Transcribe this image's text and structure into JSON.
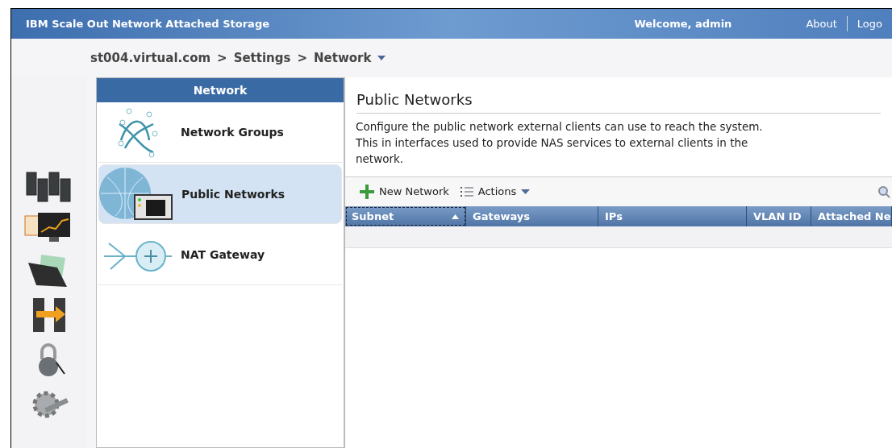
{
  "header": {
    "title": "IBM Scale Out Network Attached Storage",
    "welcome": "Welcome, admin",
    "links": [
      "About",
      "Logo"
    ]
  },
  "breadcrumb": [
    "st004.virtual.com",
    ">",
    "Settings",
    ">",
    "Network"
  ],
  "rail": [
    {
      "kind": "servers"
    },
    {
      "kind": "monitor"
    },
    {
      "kind": "folder"
    },
    {
      "kind": "migrate"
    },
    {
      "kind": "lock"
    },
    {
      "kind": "settings"
    }
  ],
  "nav": {
    "title": "Network",
    "items": [
      {
        "label": "Network Groups",
        "kind": "groups",
        "selected": false
      },
      {
        "label": "Public Networks",
        "kind": "public",
        "selected": true
      },
      {
        "label": "NAT Gateway",
        "kind": "nat",
        "selected": false
      }
    ]
  },
  "content": {
    "title": "Public Networks",
    "description": "Configure the public network external clients can use to reach the system. This in interfaces used to provide NAS services to external clients in the network.",
    "toolbar": [
      "New Network",
      "Actions"
    ],
    "table": {
      "columns": [
        {
          "label": "Subnet",
          "sorted": true
        },
        {
          "label": "Gateways",
          "sorted": false
        },
        {
          "label": "IPs",
          "sorted": false
        },
        {
          "label": "VLAN ID",
          "sorted": false
        },
        {
          "label": "Attached Ne",
          "sorted": false
        }
      ]
    }
  }
}
